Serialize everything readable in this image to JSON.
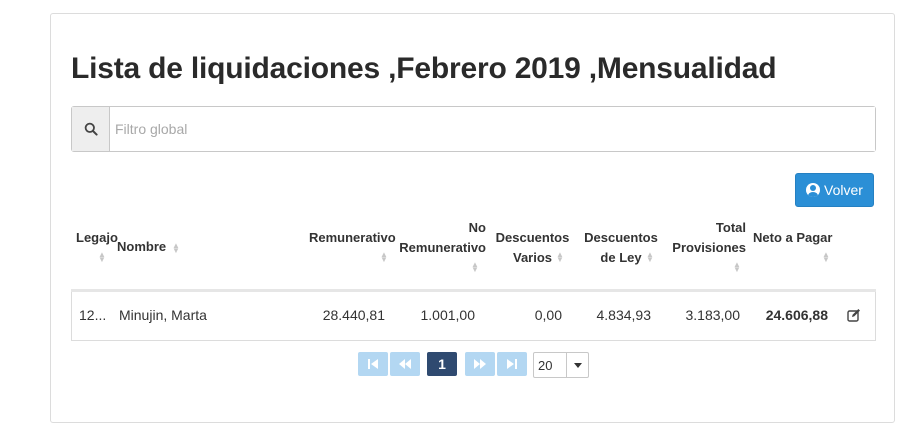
{
  "page": {
    "title": "Lista de liquidaciones ,Febrero 2019 ,Mensualidad"
  },
  "search": {
    "placeholder": "Filtro global",
    "icon": "search-icon"
  },
  "actions": {
    "volver_label": "Volver",
    "volver_icon": "user-circle-icon"
  },
  "table": {
    "columns": [
      {
        "lines": [
          "Legajo"
        ]
      },
      {
        "lines": [
          "Nombre"
        ]
      },
      {
        "lines": [
          "Remunerativo"
        ]
      },
      {
        "lines": [
          "No",
          "Remunerativo"
        ]
      },
      {
        "lines": [
          "Descuentos",
          "Varios"
        ]
      },
      {
        "lines": [
          "Descuentos",
          "de Ley"
        ]
      },
      {
        "lines": [
          "Total",
          "Provisiones"
        ]
      },
      {
        "lines": [
          "Neto a Pagar"
        ]
      }
    ],
    "rows": [
      {
        "legajo": "12...",
        "nombre": "Minujin, Marta",
        "remunerativo": "28.440,81",
        "no_remunerativo": "1.001,00",
        "descuentos_varios": "0,00",
        "descuentos_de_ley": "4.834,93",
        "total_provisiones": "3.183,00",
        "neto_a_pagar": "24.606,88",
        "action_icon": "edit-icon"
      }
    ]
  },
  "pagination": {
    "current_page": "1",
    "rows_per_page": "20"
  },
  "colors": {
    "primary_button": "#2b8fd6",
    "active_page": "#2f4a70",
    "disabled_pager": "#b3d7f2"
  }
}
